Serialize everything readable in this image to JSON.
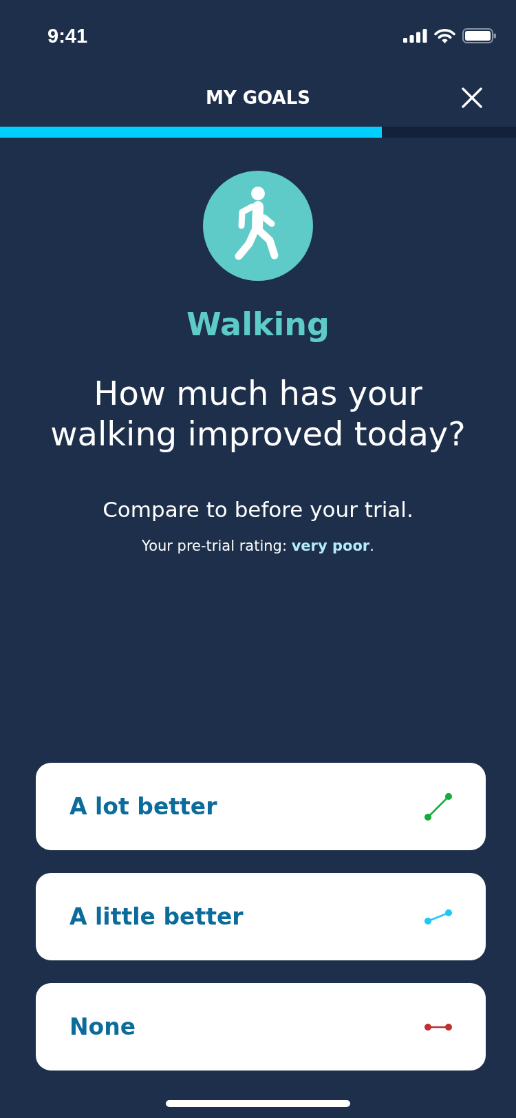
{
  "status_bar": {
    "time": "9:41"
  },
  "header": {
    "title": "MY GOALS"
  },
  "progress": {
    "level": 0.74
  },
  "goal": {
    "name": "Walking",
    "question": "How much has your walking improved today?",
    "instruction": "Compare to before your trial.",
    "rating_note": "Your pre-trial rating: **very poor**."
  },
  "options": [
    {
      "label": "A lot better",
      "kind": "steep",
      "color": "#12ad3b"
    },
    {
      "label": "A little better",
      "kind": "gentle",
      "color": "#1ec8f5"
    },
    {
      "label": "None",
      "kind": "flat",
      "color": "#c0302e"
    }
  ]
}
